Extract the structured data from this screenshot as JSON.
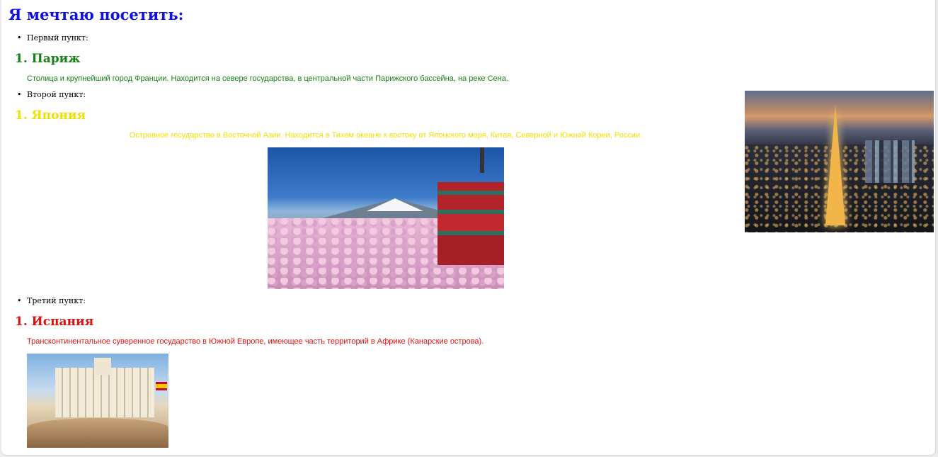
{
  "title": "Я мечтаю посетить:",
  "colors": {
    "title": "#1010e0",
    "paris": "#178017",
    "japan": "#f0e000",
    "spain": "#e01010"
  },
  "sections": [
    {
      "bullet": "Первый пункт:",
      "number": "1.",
      "heading": "Париж",
      "description": "Столица и крупнейший город Франции. Находится на севере государства, в центральной части Парижского бассейна, на реке Сена.",
      "image": "eiffel-tower-night-photo"
    },
    {
      "bullet": "Второй пункт:",
      "number": "1.",
      "heading": "Япония",
      "description": "Островное государство в Восточной Азии. Находится в Тихом океане к востоку от Японского моря, Китая, Северной и Южной Кореи, России.",
      "image": "mount-fuji-pagoda-photo"
    },
    {
      "bullet": "Третий пункт:",
      "number": "1.",
      "heading": "Испания",
      "description": "Трансконтинентальное суверенное государство в Южной Европе, имеющее часть территорий в Африке (Канарские острова).",
      "image": "madrid-cibeles-palace-photo"
    }
  ]
}
